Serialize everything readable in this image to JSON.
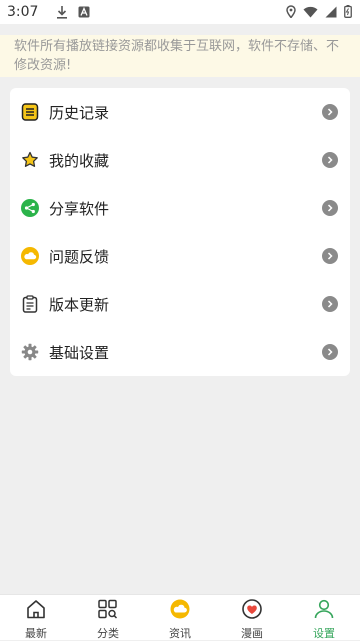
{
  "status_bar": {
    "time": "3:07"
  },
  "notice": {
    "text": "软件所有播放链接资源都收集于互联网，软件不存储、不修改资源!"
  },
  "menu": {
    "items": [
      {
        "label": "历史记录",
        "icon": "history-icon"
      },
      {
        "label": "我的收藏",
        "icon": "star-icon"
      },
      {
        "label": "分享软件",
        "icon": "share-icon"
      },
      {
        "label": "问题反馈",
        "icon": "feedback-cloud-icon"
      },
      {
        "label": "版本更新",
        "icon": "clipboard-icon"
      },
      {
        "label": "基础设置",
        "icon": "gear-icon"
      }
    ]
  },
  "tabbar": {
    "tabs": [
      {
        "label": "最新",
        "icon": "home-icon",
        "active": false
      },
      {
        "label": "分类",
        "icon": "grid-search-icon",
        "active": false
      },
      {
        "label": "资讯",
        "icon": "cloud-icon",
        "active": false
      },
      {
        "label": "漫画",
        "icon": "heart-icon",
        "active": false
      },
      {
        "label": "设置",
        "icon": "person-icon",
        "active": true
      }
    ]
  },
  "colors": {
    "accent": "#35a55b",
    "yellow": "#f5c518",
    "notice_bg": "#fdf9e6"
  }
}
